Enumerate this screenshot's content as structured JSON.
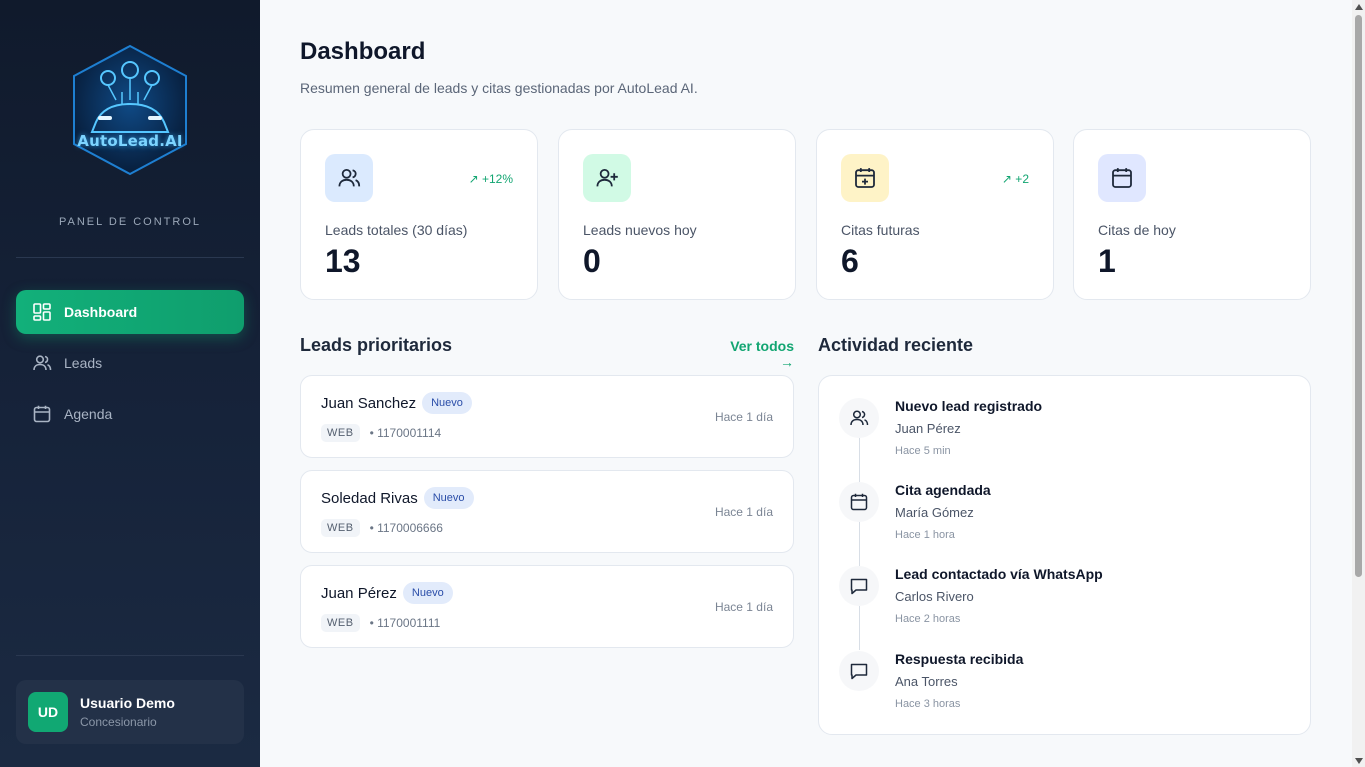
{
  "sidebar": {
    "logo_text": "AutoLead.AI",
    "panel_label": "PANEL DE CONTROL",
    "nav": [
      {
        "label": "Dashboard",
        "icon": "dashboard-grid-icon",
        "active": true
      },
      {
        "label": "Leads",
        "icon": "users-icon",
        "active": false
      },
      {
        "label": "Agenda",
        "icon": "calendar-icon",
        "active": false
      }
    ],
    "user": {
      "initials": "UD",
      "name": "Usuario Demo",
      "role": "Concesionario"
    }
  },
  "header": {
    "title": "Dashboard",
    "subtitle": "Resumen general de leads y citas gestionadas por AutoLead AI."
  },
  "stats": [
    {
      "label": "Leads totales (30 días)",
      "value": "13",
      "trend": "↗ +12%",
      "icon": "users-icon",
      "icon_bg": "#dbeafe"
    },
    {
      "label": "Leads nuevos hoy",
      "value": "0",
      "trend": "",
      "icon": "user-plus-icon",
      "icon_bg": "#d1fae5"
    },
    {
      "label": "Citas futuras",
      "value": "6",
      "trend": "↗ +2",
      "icon": "calendar-plus-icon",
      "icon_bg": "#fef3c7"
    },
    {
      "label": "Citas de hoy",
      "value": "1",
      "trend": "",
      "icon": "calendar-icon",
      "icon_bg": "#e0e7ff"
    }
  ],
  "priority_leads": {
    "title": "Leads prioritarios",
    "see_all": "Ver todos →",
    "items": [
      {
        "name": "Juan Sanchez",
        "status": "Nuevo",
        "source": "WEB",
        "phone": "• 1170001114",
        "time": "Hace 1 día"
      },
      {
        "name": "Soledad Rivas",
        "status": "Nuevo",
        "source": "WEB",
        "phone": "• 1170006666",
        "time": "Hace 1 día"
      },
      {
        "name": "Juan Pérez",
        "status": "Nuevo",
        "source": "WEB",
        "phone": "• 1170001111",
        "time": "Hace 1 día"
      }
    ]
  },
  "activity": {
    "title": "Actividad reciente",
    "items": [
      {
        "title": "Nuevo lead registrado",
        "person": "Juan Pérez",
        "time": "Hace 5 min",
        "icon": "users-icon"
      },
      {
        "title": "Cita agendada",
        "person": "María Gómez",
        "time": "Hace 1 hora",
        "icon": "calendar-icon"
      },
      {
        "title": "Lead contactado vía WhatsApp",
        "person": "Carlos Rivero",
        "time": "Hace 2 horas",
        "icon": "message-icon"
      },
      {
        "title": "Respuesta recibida",
        "person": "Ana Torres",
        "time": "Hace 3 horas",
        "icon": "message-icon"
      }
    ]
  },
  "colors": {
    "accent": "#12a571",
    "sidebar_bg": "#131f33",
    "trend": "#12a571"
  }
}
